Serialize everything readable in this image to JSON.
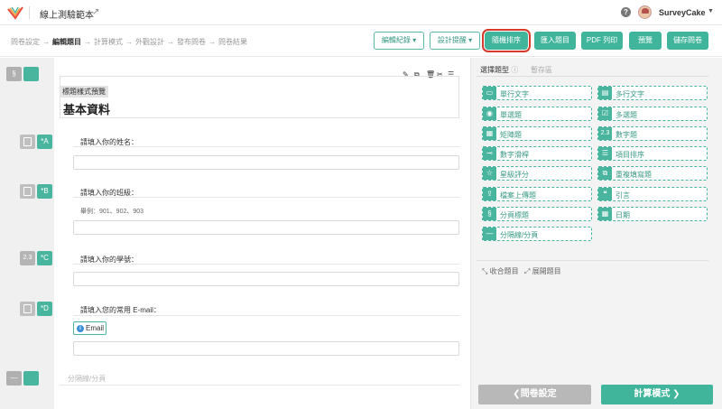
{
  "header": {
    "app_title": "線上測驗範本",
    "user_name": "SurveyCake",
    "help_symbol": "?"
  },
  "steps": [
    {
      "label": "問卷設定",
      "active": false
    },
    {
      "label": "編輯題目",
      "active": true
    },
    {
      "label": "計算模式",
      "active": false
    },
    {
      "label": "外觀設計",
      "active": false
    },
    {
      "label": "發布問卷",
      "active": false
    },
    {
      "label": "問卷結果",
      "active": false
    }
  ],
  "toolbar": {
    "edit_log": "編輯紀錄",
    "design_tips": "設計提醒",
    "random_order": "隨機排序",
    "import_questions": "匯入題目",
    "pdf_print": "PDF 列印",
    "preview": "預覽",
    "save": "儲存問卷"
  },
  "editor": {
    "section_tag": "§",
    "title_style_label": "標題樣式預覽",
    "section_title": "基本資料",
    "questions": [
      {
        "letter": "A",
        "label": "請填入你的姓名：",
        "hint": ""
      },
      {
        "letter": "B",
        "label": "請填入你的班級：",
        "hint": "舉例：901、902、903"
      },
      {
        "letter": "C",
        "label": "請填入你的學號：",
        "hint": ""
      },
      {
        "letter": "D",
        "label": "請填入您的常用 E-mail：",
        "hint": ""
      }
    ],
    "email_badge": "Email",
    "divider_placeholder": "分隔線/分頁"
  },
  "panel": {
    "tab_question_types": "選擇題型",
    "tab_staging": "暫存區",
    "question_types": [
      {
        "label": "單行文字",
        "icon": "single-line-icon"
      },
      {
        "label": "多行文字",
        "icon": "multi-line-icon"
      },
      {
        "label": "單選題",
        "icon": "radio-icon"
      },
      {
        "label": "多選題",
        "icon": "checkbox-icon"
      },
      {
        "label": "矩陣題",
        "icon": "matrix-icon"
      },
      {
        "label": "數字題",
        "icon": "number-icon"
      },
      {
        "label": "數字滑桿",
        "icon": "slider-icon"
      },
      {
        "label": "項目排序",
        "icon": "sort-icon"
      },
      {
        "label": "星級評分",
        "icon": "star-icon"
      },
      {
        "label": "重複填寫題",
        "icon": "repeat-icon"
      },
      {
        "label": "檔案上傳題",
        "icon": "upload-icon"
      },
      {
        "label": "引言",
        "icon": "quote-icon"
      },
      {
        "label": "分頁標題",
        "icon": "page-title-icon"
      },
      {
        "label": "日期",
        "icon": "date-icon"
      },
      {
        "label": "分隔線/分頁",
        "icon": "divider-icon"
      }
    ],
    "collapse_label": "收合題目",
    "expand_label": "展開題目"
  },
  "footer": {
    "back_label": "問卷設定",
    "next_label": "計算模式"
  },
  "colors": {
    "accent": "#40b59b",
    "highlight": "#d63a2a"
  }
}
